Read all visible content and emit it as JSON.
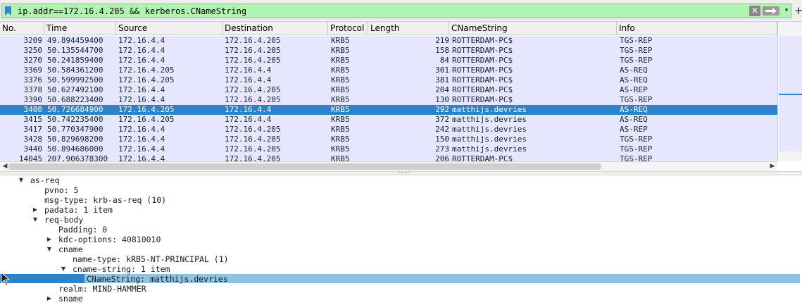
{
  "filter": {
    "expression": "ip.addr==172.16.4.205 && kerberos.CNameString",
    "background": "#aff5b0",
    "clear_icon": "✕",
    "apply_icon": "arrow-right-icon",
    "dropdown_icon": "▾",
    "plus_icon": "+"
  },
  "columns": [
    "No.",
    "Time",
    "Source",
    "Destination",
    "Protocol",
    "Length",
    "CNameString",
    "Info"
  ],
  "packets": [
    {
      "no": "3209",
      "time": "49.894459400",
      "src": "172.16.4.4",
      "dst": "172.16.4.205",
      "proto": "KRB5",
      "len": "219",
      "cname": "ROTTERDAM-PC$",
      "info": "TGS-REP"
    },
    {
      "no": "3250",
      "time": "50.135544700",
      "src": "172.16.4.4",
      "dst": "172.16.4.205",
      "proto": "KRB5",
      "len": "158",
      "cname": "ROTTERDAM-PC$",
      "info": "TGS-REP"
    },
    {
      "no": "3270",
      "time": "50.241859400",
      "src": "172.16.4.4",
      "dst": "172.16.4.205",
      "proto": "KRB5",
      "len": "84",
      "cname": "ROTTERDAM-PC$",
      "info": "TGS-REP"
    },
    {
      "no": "3369",
      "time": "50.584361200",
      "src": "172.16.4.205",
      "dst": "172.16.4.4",
      "proto": "KRB5",
      "len": "301",
      "cname": "ROTTERDAM-PC$",
      "info": "AS-REQ"
    },
    {
      "no": "3376",
      "time": "50.599992500",
      "src": "172.16.4.205",
      "dst": "172.16.4.4",
      "proto": "KRB5",
      "len": "381",
      "cname": "ROTTERDAM-PC$",
      "info": "AS-REQ"
    },
    {
      "no": "3378",
      "time": "50.627492100",
      "src": "172.16.4.4",
      "dst": "172.16.4.205",
      "proto": "KRB5",
      "len": "204",
      "cname": "ROTTERDAM-PC$",
      "info": "AS-REP"
    },
    {
      "no": "3390",
      "time": "50.688223400",
      "src": "172.16.4.4",
      "dst": "172.16.4.205",
      "proto": "KRB5",
      "len": "130",
      "cname": "ROTTERDAM-PC$",
      "info": "TGS-REP"
    },
    {
      "no": "3408",
      "time": "50.726684900",
      "src": "172.16.4.205",
      "dst": "172.16.4.4",
      "proto": "KRB5",
      "len": "292",
      "cname": "matthijs.devries",
      "info": "AS-REQ"
    },
    {
      "no": "3415",
      "time": "50.742235400",
      "src": "172.16.4.205",
      "dst": "172.16.4.4",
      "proto": "KRB5",
      "len": "372",
      "cname": "matthijs.devries",
      "info": "AS-REQ"
    },
    {
      "no": "3417",
      "time": "50.770347900",
      "src": "172.16.4.4",
      "dst": "172.16.4.205",
      "proto": "KRB5",
      "len": "242",
      "cname": "matthijs.devries",
      "info": "AS-REP"
    },
    {
      "no": "3428",
      "time": "50.829698200",
      "src": "172.16.4.4",
      "dst": "172.16.4.205",
      "proto": "KRB5",
      "len": "150",
      "cname": "matthijs.devries",
      "info": "TGS-REP"
    },
    {
      "no": "3440",
      "time": "50.894686000",
      "src": "172.16.4.4",
      "dst": "172.16.4.205",
      "proto": "KRB5",
      "len": "273",
      "cname": "matthijs.devries",
      "info": "TGS-REP"
    },
    {
      "no": "14045",
      "time": "207.906378300",
      "src": "172.16.4.4",
      "dst": "172.16.4.205",
      "proto": "KRB5",
      "len": "206",
      "cname": "ROTTERDAM-PC$",
      "info": "TGS-REP"
    }
  ],
  "selected_packet": "3408",
  "colors": {
    "row_bg": "#e7e6ff",
    "row_text": "#12272e",
    "selected_bg": "#2f81c8",
    "selected_text": "#ffffff",
    "field_highlight": "#8fc3e4"
  },
  "details_tree": [
    {
      "text": "as-req",
      "toggle": "expanded",
      "level": 0
    },
    {
      "text": "pvno: 5",
      "toggle": "none",
      "level": 1
    },
    {
      "text": "msg-type: krb-as-req (10)",
      "toggle": "none",
      "level": 1
    },
    {
      "text": "padata: 1 item",
      "toggle": "collapsed",
      "level": 1
    },
    {
      "text": "req-body",
      "toggle": "expanded",
      "level": 1
    },
    {
      "text": "Padding: 0",
      "toggle": "none",
      "level": 2
    },
    {
      "text": "kdc-options: 40810010",
      "toggle": "collapsed",
      "level": 2
    },
    {
      "text": "cname",
      "toggle": "expanded",
      "level": 2
    },
    {
      "text": "name-type: kRB5-NT-PRINCIPAL (1)",
      "toggle": "none",
      "level": 3
    },
    {
      "text": "cname-string: 1 item",
      "toggle": "expanded",
      "level": 3
    },
    {
      "text": "CNameString: matthijs.devries",
      "toggle": "none",
      "level": 4,
      "selected": true
    },
    {
      "text": "realm: MIND-HAMMER",
      "toggle": "none",
      "level": 2
    },
    {
      "text": "sname",
      "toggle": "collapsed",
      "level": 2
    }
  ]
}
